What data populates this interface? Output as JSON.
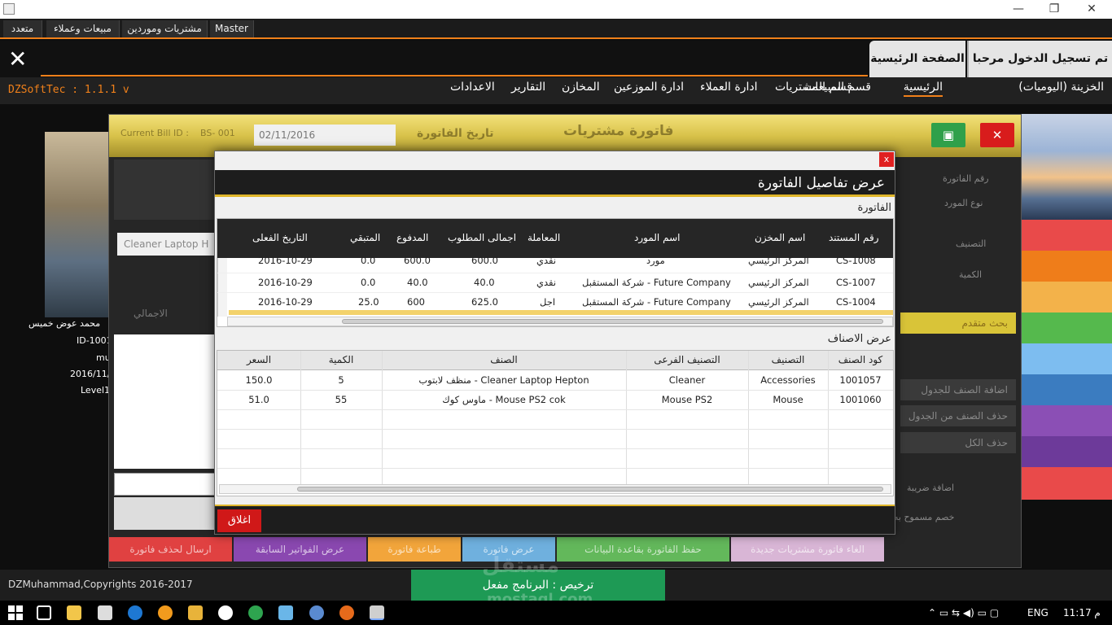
{
  "titlebar": {
    "minimize": "—",
    "maximize": "❐",
    "close": "✕"
  },
  "menu": [
    "Master",
    "مشتريات وموردين",
    "مبيعات وعملاء",
    "متعدد"
  ],
  "header": {
    "close_glyph": "✕",
    "crumb_home": "الصفحة الرئيسية",
    "crumb_welcome": "تم تسجيل الدخول مرحبا بك"
  },
  "brand": "DZSoftTec : 1.1.1 v",
  "nav": [
    "الخزينة (اليوميات)",
    "الرئيسية",
    "قسم المبيعات",
    "قسم المشتريات",
    "ادارة العملاء",
    "ادارة الموزعين",
    "المخازن",
    "التقارير",
    "الاعدادات"
  ],
  "profile": {
    "name": "محمد عوض خميس",
    "id": "ID-1001",
    "user": "mu",
    "date": "2016/11/",
    "level": "Level1"
  },
  "bg_window": {
    "title": "فاتورة مشتريات",
    "current_bill_label": "Current Bill ID :",
    "current_bill_value": "BS- 001",
    "date": "02/11/2016",
    "date_label": "تاريخ الفاتورة",
    "invoice_no_label": "رقم الفاتورة",
    "supplier_type_label": "نوع المورد",
    "category_label": "التصنيف",
    "qty_label": "الكمية",
    "item_placeholder": "Cleaner Laptop H",
    "total_label": "الاجمالي",
    "advanced_search": "بحث متقدم",
    "add_item": "اضافة الصنف للجدول",
    "delete_item": "حذف الصنف من الجدول",
    "delete_all": "حذف الكل",
    "add_tax": "اضافة ضريبة",
    "discount": "خصم مسموح به",
    "bottom_buttons": [
      "الغاء فاتورة مشتريات جديدة",
      "حفظ الفاتورة بقاعدة البيانات",
      "عرض فاتورة",
      "طباعة فاتورة",
      "عرض الفواتير السابقة",
      "ارسال لحذف فاتورة"
    ]
  },
  "dialog": {
    "close_x": "x",
    "title": "عرض تفاصيل الفاتورة",
    "invoice_section": "الفاتورة",
    "items_section": "عرض الاصناف",
    "close_button": "اغلاق",
    "invoices": {
      "columns": [
        "رقم المستند",
        "اسم المخزن",
        "اسم المورد",
        "المعاملة",
        "اجمالى المطلوب",
        "المدفوع",
        "المتبقي",
        "التاريخ الفعلى"
      ],
      "rows": [
        [
          "CS-1008",
          "المركز الرئيسي",
          "مورد",
          "نقدي",
          "600.0",
          "600.0",
          "0.0",
          "2016-10-29"
        ],
        [
          "CS-1007",
          "المركز الرئيسي",
          "شركة المستقبل - Future Company",
          "نقدي",
          "40.0",
          "40.0",
          "0.0",
          "2016-10-29"
        ],
        [
          "CS-1004",
          "المركز الرئيسي",
          "شركة المستقبل - Future Company",
          "اجل",
          "625.0",
          "600",
          "25.0",
          "2016-10-29"
        ]
      ]
    },
    "items": {
      "columns": [
        "كود الصنف",
        "التصنيف",
        "التصنيف الفرعى",
        "الصنف",
        "الكمية",
        "السعر"
      ],
      "rows": [
        [
          "1001057",
          "Accessories",
          "Cleaner",
          "منظف لابتوب - Cleaner Laptop Hepton",
          "5",
          "150.0"
        ],
        [
          "1001060",
          "Mouse",
          "Mouse PS2",
          "ماوس كوك - Mouse PS2 cok",
          "55",
          "51.0"
        ]
      ]
    }
  },
  "footer": {
    "copyright": "DZMuhammad,Copyrights 2016-2017",
    "license": "ترخيص : البرنامج مفعل",
    "watermark_ar": "مستقل",
    "watermark_en": "mostaql.com"
  },
  "taskbar": {
    "lang": "ENG",
    "time": "11:17 م"
  },
  "colors": {
    "accent": "#f0801a",
    "gold": "#e0b62a",
    "danger": "#d01818",
    "success": "#1e9a55"
  }
}
